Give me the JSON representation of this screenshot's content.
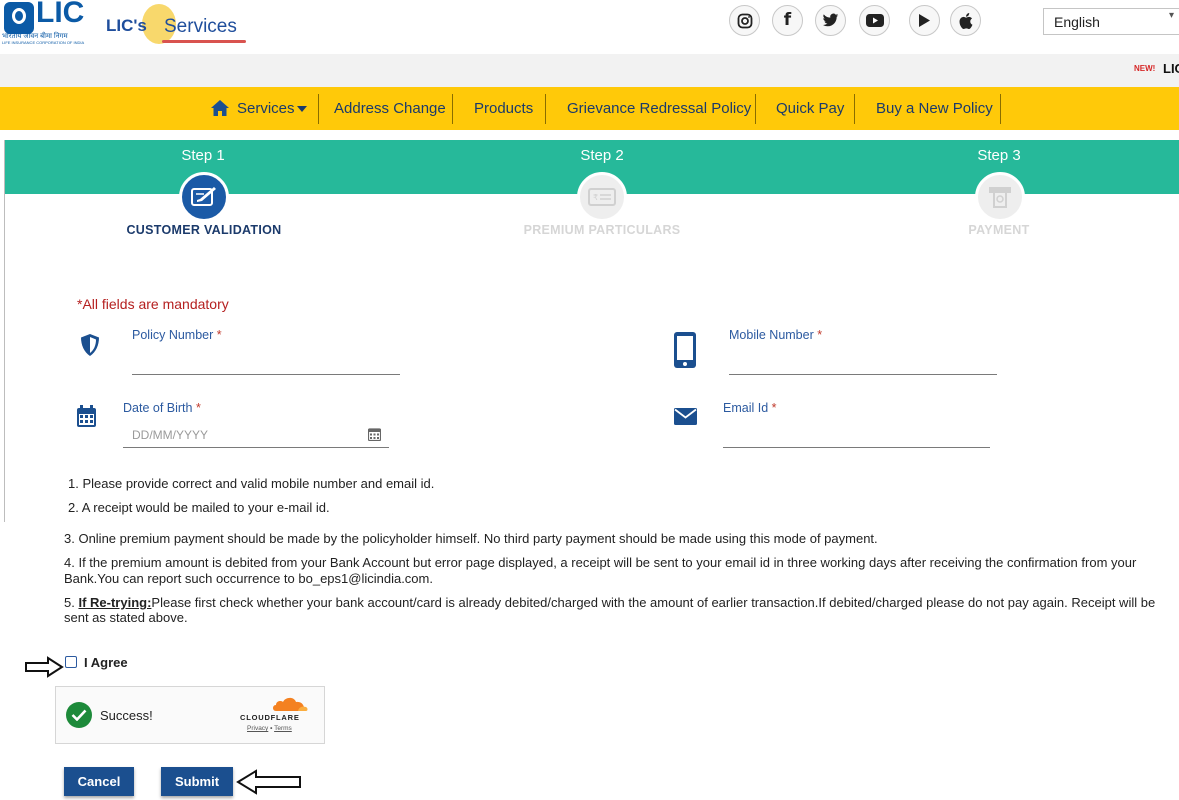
{
  "header": {
    "lic_logo": {
      "word": "LIC",
      "hindi": "भारतीय जीवन बीमा निगम",
      "sub": "LIFE INSURANCE CORPORATION OF INDIA"
    },
    "eservices_logo": {
      "prefix": "LIC's",
      "word": "Services"
    },
    "social": [
      {
        "name": "instagram-icon",
        "glyph": "◎"
      },
      {
        "name": "facebook-icon",
        "glyph": "f"
      },
      {
        "name": "twitter-icon",
        "glyph": "🐦"
      },
      {
        "name": "youtube-icon",
        "glyph": "▶"
      },
      {
        "name": "google-play-icon",
        "glyph": "▶"
      },
      {
        "name": "apple-icon",
        "glyph": ""
      }
    ],
    "language": {
      "selected": "English"
    }
  },
  "ticker": {
    "badge": "NEW!",
    "text": "LIC"
  },
  "nav": {
    "items": [
      "Services",
      "Address Change",
      "Products",
      "Grievance Redressal Policy",
      "Quick Pay",
      "Buy a New Policy"
    ]
  },
  "steps": [
    {
      "label": "Step 1",
      "title": "CUSTOMER VALIDATION",
      "state": "active"
    },
    {
      "label": "Step 2",
      "title": "PREMIUM PARTICULARS",
      "state": "inactive"
    },
    {
      "label": "Step 3",
      "title": "PAYMENT",
      "state": "inactive"
    }
  ],
  "form": {
    "mandatory_note": "*All fields are mandatory",
    "policy_number": {
      "label": "Policy Number",
      "req": "*"
    },
    "mobile_number": {
      "label": "Mobile Number",
      "req": "*"
    },
    "dob": {
      "label": "Date of Birth",
      "req": "*",
      "placeholder": "DD/MM/YYYY"
    },
    "email": {
      "label": "Email Id",
      "req": "*"
    }
  },
  "notes": {
    "n1": "1. Please provide correct and valid mobile number and email id.",
    "n2": "2. A receipt would be mailed to your e-mail id.",
    "n3": "3. Online premium payment should be made by the policyholder himself. No third party payment should be made using this mode of payment.",
    "n4a": "4. If the premium amount is debited from your Bank Account but error page displayed, a receipt will be sent to your email id in three working days after receiving the confirmation from your",
    "n4b": "Bank.You can report such occurrence to bo_eps1@licindia.com.",
    "n5_prefix": "5.",
    "n5_bold": "If Re-trying:",
    "n5a": "Please first check whether your bank account/card is already debited/charged with the amount of earlier transaction.If debited/charged please do not pay again. Receipt will be",
    "n5b": "sent as stated above."
  },
  "agree": {
    "label": "I Agree",
    "checked": false
  },
  "captcha": {
    "status": "Success!",
    "brand": "CLOUDFLARE",
    "privacy": "Privacy",
    "dot": "•",
    "terms": "Terms"
  },
  "buttons": {
    "cancel": "Cancel",
    "submit": "Submit"
  },
  "colors": {
    "nav_bg": "#ffc909",
    "step_bar": "#26b99a",
    "primary": "#1b4f8f",
    "error": "#b52020"
  }
}
